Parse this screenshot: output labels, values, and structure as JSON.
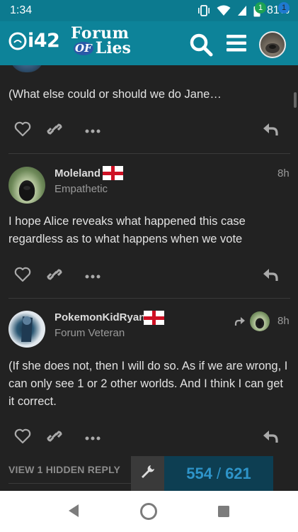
{
  "status_bar": {
    "time": "1:34",
    "battery": "81%",
    "icons": [
      "vibrate-icon",
      "wifi-icon",
      "signal-icon",
      "battery-icon"
    ]
  },
  "header": {
    "logo_left_text": "i42",
    "logo_title_line1": "Forum",
    "logo_title_of": "OF",
    "logo_title_lies": "Lies",
    "notification_count_green": "1",
    "notification_count_blue": "1",
    "colors": {
      "header_bg": "#0d8399",
      "status_bg": "#0c7a8f"
    }
  },
  "posts": [
    {
      "text": "(What else could or should we do Jane…"
    },
    {
      "username": "Moleland",
      "user_title": "Empathetic",
      "time": "8h",
      "text": "I hope Alice reveaks what happened this case regardless as to what happens when we vote"
    },
    {
      "username": "PokemonKidRyan",
      "user_title": "Forum Veteran",
      "time": "8h",
      "text": "(If she does not, then I will do so. As if we are wrong, I can only see 1 or 2 other worlds. And I think I can get it correct."
    }
  ],
  "footer": {
    "hidden_reply_label": "VIEW 1 HIDDEN REPLY",
    "progress_current": "554",
    "progress_separator": "/",
    "progress_total": "621"
  }
}
